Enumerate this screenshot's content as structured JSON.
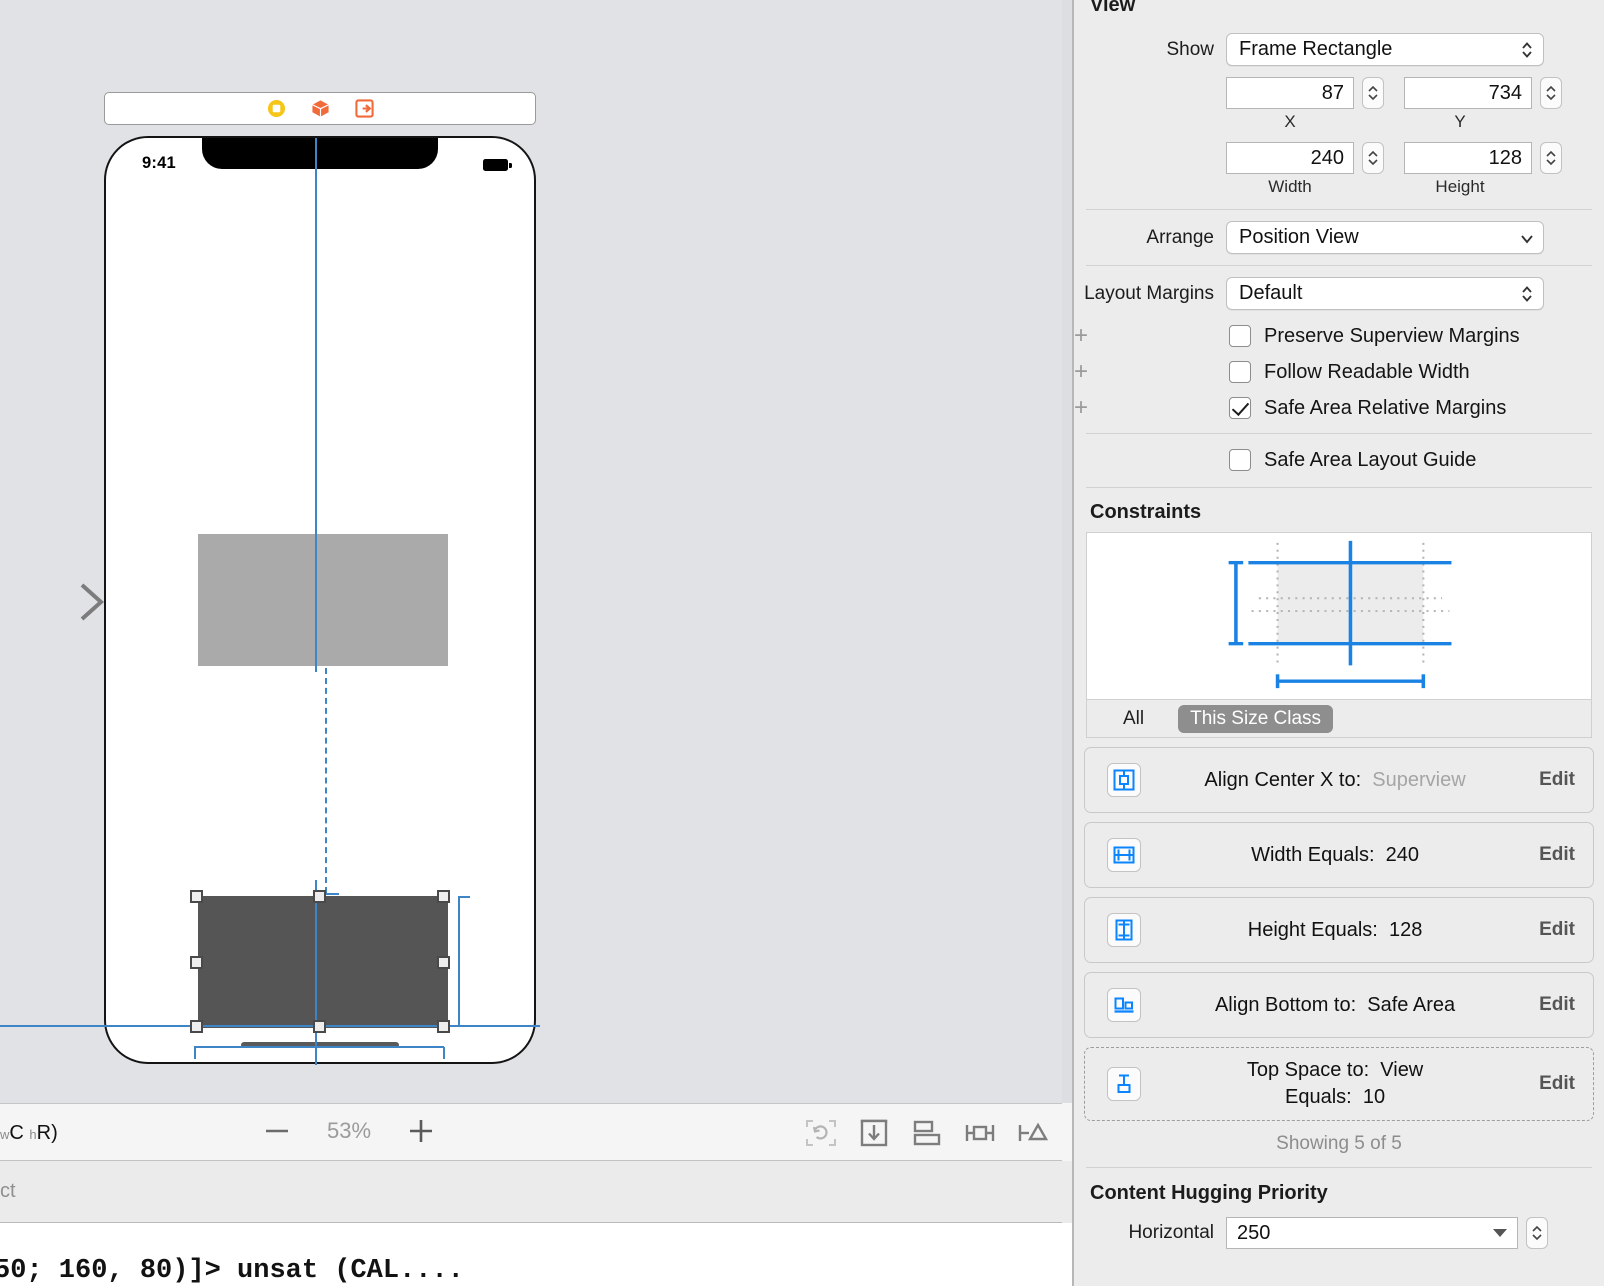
{
  "canvas": {
    "dock_icons": [
      "view-controller-icon",
      "first-responder-icon",
      "exit-icon"
    ],
    "device": {
      "status_time": "9:41",
      "battery": "battery-icon"
    },
    "entry_arrow": "storyboard-entry-point-arrow"
  },
  "canvas_toolbar": {
    "size_class_prefix": "w",
    "size_class_w": "C",
    "size_class_h_prefix": "h",
    "size_class_h": "R",
    "size_class_suffix": ")",
    "zoom_out": "—",
    "zoom_value": "53%",
    "zoom_in": "+",
    "tools": [
      "update-frames-icon",
      "embed-in-icon",
      "align-icon",
      "add-new-constraints-icon",
      "resolve-auto-layout-issues-icon"
    ]
  },
  "filter_bar": {
    "text": "ct"
  },
  "console": {
    "text": "50; 160, 80)]> unsat (CAL...."
  },
  "inspector": {
    "view_section": {
      "title": "View",
      "show_label": "Show",
      "show_value": "Frame Rectangle",
      "x_value": "87",
      "x_caption": "X",
      "y_value": "734",
      "y_caption": "Y",
      "width_value": "240",
      "width_caption": "Width",
      "height_value": "128",
      "height_caption": "Height",
      "arrange_label": "Arrange",
      "arrange_value": "Position View",
      "layout_margins_label": "Layout Margins",
      "layout_margins_value": "Default",
      "checkboxes": [
        {
          "label": "Preserve Superview Margins",
          "checked": false,
          "has_plus": true
        },
        {
          "label": "Follow Readable Width",
          "checked": false,
          "has_plus": true
        },
        {
          "label": "Safe Area Relative Margins",
          "checked": true,
          "has_plus": true
        }
      ],
      "safe_area_layout_guide": {
        "label": "Safe Area Layout Guide",
        "checked": false
      }
    },
    "constraints_section": {
      "title": "Constraints",
      "size_class_all": "All",
      "size_class_this": "This Size Class",
      "edit_label": "Edit",
      "rows": [
        {
          "icon": "align-center-x-icon",
          "key": "Align Center X to:",
          "value": "Superview",
          "dim": true,
          "dashed": false
        },
        {
          "icon": "width-icon",
          "key": "Width Equals:",
          "value": "240",
          "dim": false,
          "dashed": false
        },
        {
          "icon": "height-icon",
          "key": "Height Equals:",
          "value": "128",
          "dim": false,
          "dashed": false
        },
        {
          "icon": "align-bottom-icon",
          "key": "Align Bottom to:",
          "value": "Safe Area",
          "dim": false,
          "dashed": false
        },
        {
          "icon": "top-space-icon",
          "key": "Top Space to:",
          "value": "View",
          "key2": "Equals:",
          "value2": "10",
          "dim": false,
          "dashed": true
        }
      ],
      "showing_count": "Showing 5 of 5"
    },
    "content_hugging": {
      "title": "Content Hugging Priority",
      "horizontal_label": "Horizontal",
      "horizontal_value": "250"
    }
  },
  "colors": {
    "accent_blue": "#3d85c6",
    "light_view": "#aaaaab",
    "dark_view": "#555556",
    "canvas_bg": "#e0e2e5",
    "inspector_bg": "#ececec",
    "segment_active": "#8e8e8e"
  }
}
